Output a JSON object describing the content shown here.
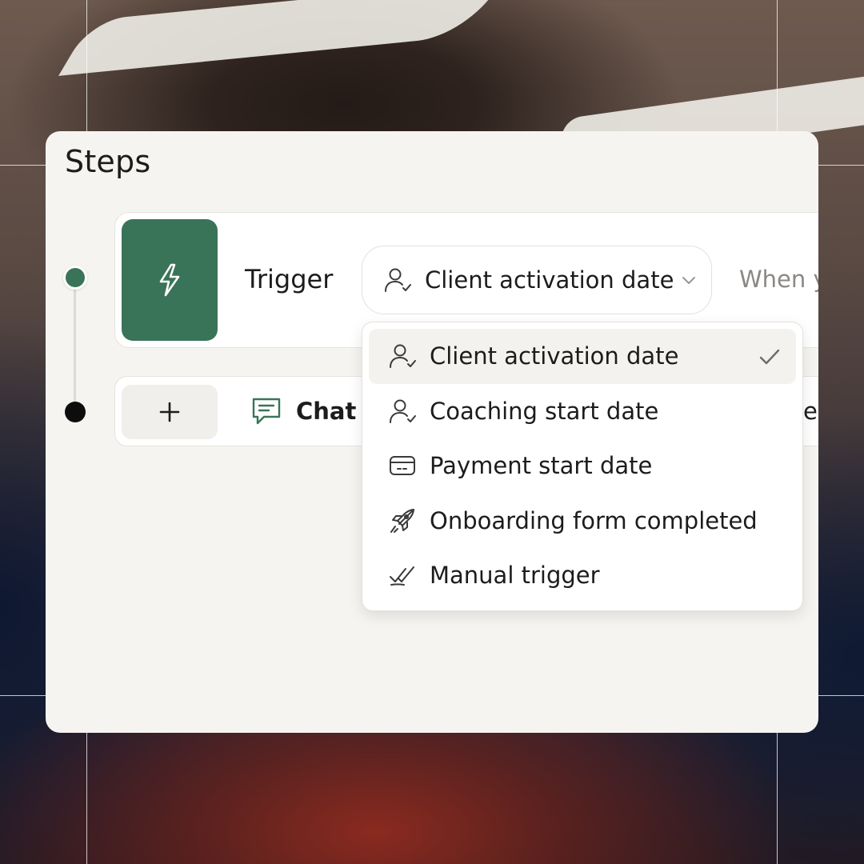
{
  "panel": {
    "title": "Steps"
  },
  "trigger": {
    "label": "Trigger",
    "selected_value": "Client activation date",
    "trailing_text": "When y"
  },
  "step": {
    "label": "Chat r",
    "trailing_text": "eo"
  },
  "dropdown": {
    "items": [
      {
        "label": "Client activation date",
        "icon": "user-check-icon",
        "selected": true
      },
      {
        "label": "Coaching start date",
        "icon": "user-check-icon",
        "selected": false
      },
      {
        "label": "Payment start date",
        "icon": "credit-card-icon",
        "selected": false
      },
      {
        "label": "Onboarding form completed",
        "icon": "rocket-icon",
        "selected": false
      },
      {
        "label": "Manual trigger",
        "icon": "double-check-icon",
        "selected": false
      }
    ]
  },
  "colors": {
    "accent_green": "#3a7458",
    "panel_bg": "#f6f4f0",
    "text_primary": "#1c1c1c",
    "text_muted": "#8b8883"
  }
}
